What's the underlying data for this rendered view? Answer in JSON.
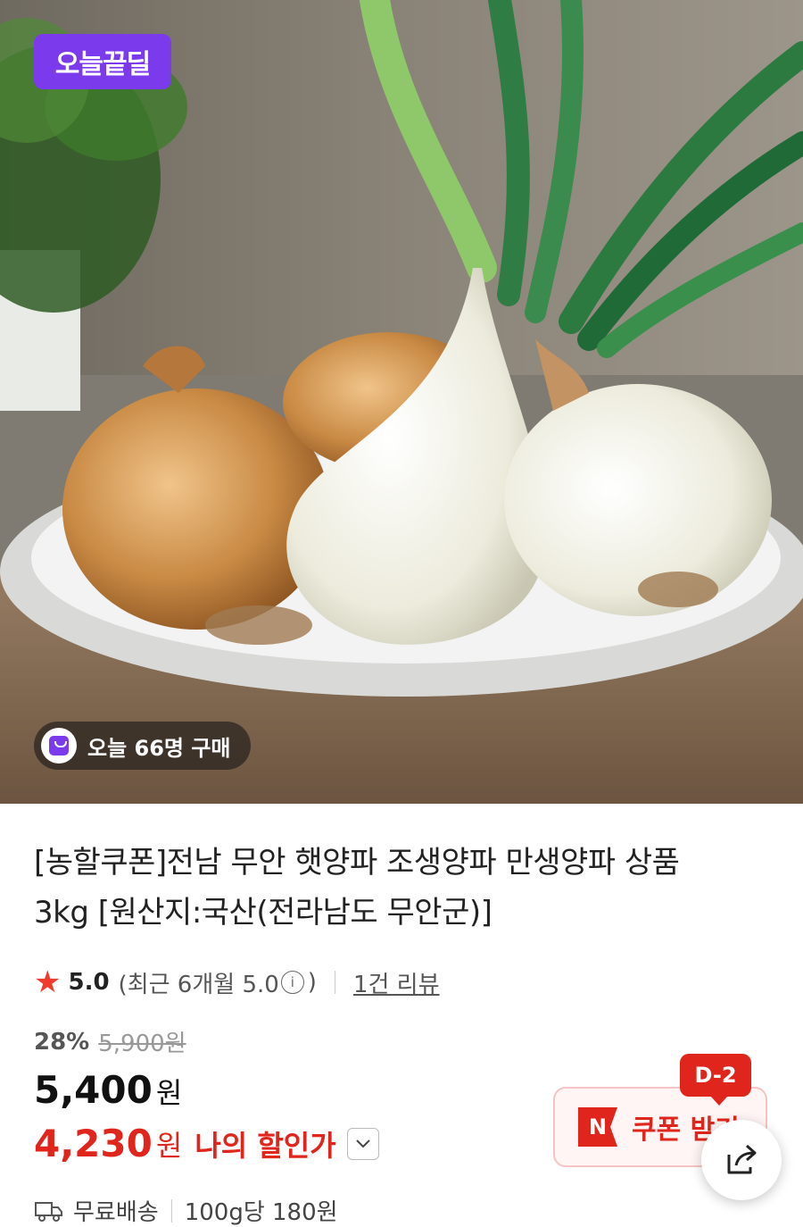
{
  "hero": {
    "deal_badge": "오늘끝딜",
    "buyers_chip": "오늘 66명 구매"
  },
  "product": {
    "title_line1": "[농할쿠폰]전남 무안 햇양파 조생양파 만생양파 상품",
    "title_line2": "3kg [원산지:국산(전라남도 무안군)]"
  },
  "rating": {
    "score": "5.0",
    "recent_prefix": "(최근 6개월 5.0",
    "recent_suffix": ")",
    "info_glyph": "i",
    "review_count": "1건 리뷰"
  },
  "pricing": {
    "discount_rate": "28%",
    "original_price": "5,900원",
    "sale_price": "5,400",
    "sale_unit": "원",
    "my_price": "4,230",
    "my_unit": "원",
    "my_label": "나의 할인가"
  },
  "coupon": {
    "dday": "D-2",
    "logo": "N",
    "label": "쿠폰 받기"
  },
  "shipping": {
    "free_label": "무료배송",
    "unit_price": "100g당 180원"
  },
  "colors": {
    "brand_purple": "#7c3aed",
    "accent_red": "#e0261c"
  },
  "icons": [
    "shopping-bag-icon",
    "star-icon",
    "info-icon",
    "chevron-down-icon",
    "share-icon",
    "truck-icon"
  ]
}
